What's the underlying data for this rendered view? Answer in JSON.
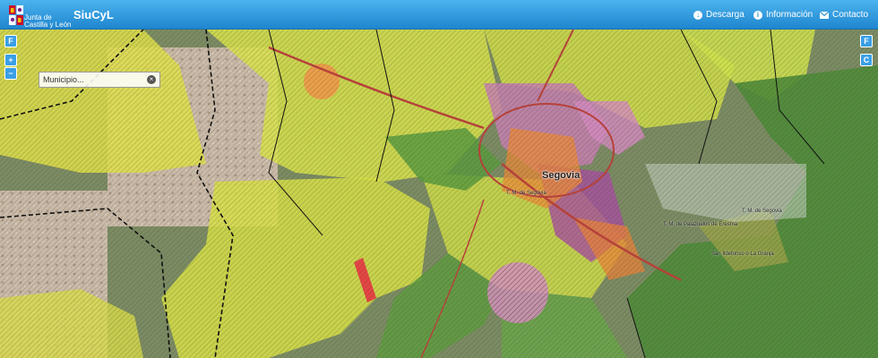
{
  "header": {
    "logo_line1": "Junta de",
    "logo_line2": "Castilla y León",
    "app_title": "SiuCyL",
    "nav": [
      {
        "label": "Descarga",
        "icon": "download-icon"
      },
      {
        "label": "Información",
        "icon": "info-icon"
      },
      {
        "label": "Contacto",
        "icon": "mail-icon"
      }
    ]
  },
  "controls": {
    "left": [
      "F",
      "+",
      "−"
    ],
    "right": [
      "F",
      "C"
    ]
  },
  "search": {
    "value": "Municipio..."
  },
  "map": {
    "city_label": "Segovia",
    "municipality_labels": [
      "T. M. de Segovia",
      "T. M. de Palazuelos de Eresma",
      "San Ildefonso o La Granja",
      "T. M. de Segovia"
    ]
  },
  "colors": {
    "header_top": "#4bb3ef",
    "header_bottom": "#1f86cf",
    "control": "#3a9fe6"
  }
}
